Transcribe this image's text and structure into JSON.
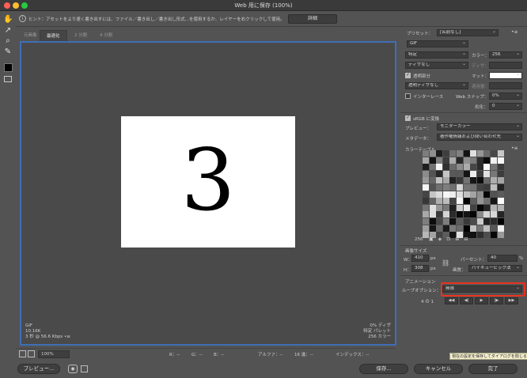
{
  "window": {
    "title": "Web 用に保存 (100%)"
  },
  "hint": {
    "text": "ヒント：アセットをより速く書き出すには、ファイル／書き出し／書き出し形式...を使用するか、レイヤーを右クリックして使用。",
    "detail_button": "詳細"
  },
  "tabs": [
    "元画像",
    "最適化",
    "2 分割",
    "4 分割"
  ],
  "canvas": {
    "artboard_text": "3",
    "info_left": [
      "GIF",
      "10.16K",
      "3 秒 @ 56.6 Kbps"
    ],
    "info_left_menu": "•≡",
    "info_right": [
      "0% ディザ",
      "特定 パレット",
      "256 カラー"
    ]
  },
  "statusbar": {
    "zoom": "100%",
    "r": "R：--",
    "g": "G：--",
    "b": "B：--",
    "alpha": "アルファ：--",
    "hex": "16 進：--",
    "index": "インデックス：--"
  },
  "buttons": {
    "preview": "プレビュー...",
    "save": "保存...",
    "cancel": "キャンセル",
    "done": "完了"
  },
  "tooltip": "現在の設定を保存してダイアログを閉じる",
  "panel": {
    "preset_label": "プリセット：",
    "preset_value": "[名前なし]",
    "format": "GIF",
    "reduction": "特定",
    "colors_label": "カラー：",
    "colors_value": "256",
    "dither_algo": "ディザなし",
    "dither_label": "ディザ：",
    "transparency_label": "透明部分",
    "matte_label": "マット：",
    "matte_color": "#ffffff",
    "trans_dither": "透明ディザなし",
    "amount_label": "適用量：",
    "interlace_label": "インターレース",
    "websnap_label": "Web スナップ：",
    "websnap_value": "0%",
    "lossy_label": "劣化：",
    "lossy_value": "0",
    "srgb_label": "sRGB に変換",
    "preview_label": "プレビュー：",
    "preview_value": "モニターカラー",
    "metadata_label": "メタデータ：",
    "metadata_value": "著作権情報および問い合わせ先",
    "colortable_label": "カラーテーブル",
    "colortable_count": "256",
    "imagesize_label": "画像サイズ",
    "w_label": "W：",
    "w_value": "410",
    "h_label": "H：",
    "h_value": "308",
    "px": "px",
    "percent_label": "パーセント：",
    "percent_value": "40",
    "percent_unit": "%",
    "quality_label": "画質：",
    "quality_value": "バイキュービック法",
    "animation_label": "アニメーション",
    "loop_label": "ループオプション：",
    "loop_value": "無限",
    "frame_counter": "4 の 1"
  }
}
